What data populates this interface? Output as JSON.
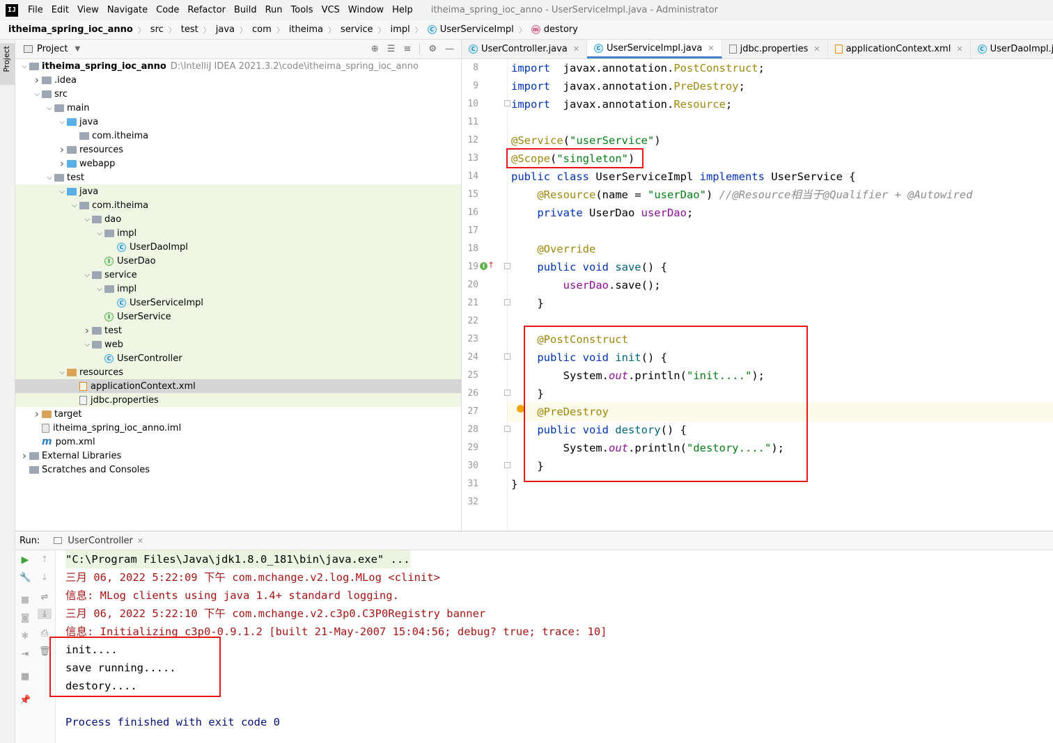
{
  "menubar": {
    "logo": "IJ",
    "items": [
      "File",
      "Edit",
      "View",
      "Navigate",
      "Code",
      "Refactor",
      "Build",
      "Run",
      "Tools",
      "VCS",
      "Window",
      "Help"
    ],
    "window_title": "itheima_spring_ioc_anno - UserServiceImpl.java - Administrator"
  },
  "breadcrumb": {
    "project": "itheima_spring_ioc_anno",
    "parts": [
      "src",
      "test",
      "java",
      "com",
      "itheima",
      "service",
      "impl"
    ],
    "class": "UserServiceImpl",
    "method": "destory"
  },
  "sidebar": {
    "tab": "Project"
  },
  "project_panel": {
    "title": "Project",
    "tree": [
      {
        "label": "itheima_spring_ioc_anno",
        "path": "D:\\IntelliJ IDEA 2021.3.2\\code\\itheima_spring_ioc_anno"
      },
      {
        "label": ".idea"
      },
      {
        "label": "src"
      },
      {
        "label": "main"
      },
      {
        "label": "java"
      },
      {
        "label": "com.itheima"
      },
      {
        "label": "resources"
      },
      {
        "label": "webapp"
      },
      {
        "label": "test"
      },
      {
        "label": "java"
      },
      {
        "label": "com.itheima"
      },
      {
        "label": "dao"
      },
      {
        "label": "impl"
      },
      {
        "label": "UserDaoImpl"
      },
      {
        "label": "UserDao"
      },
      {
        "label": "service"
      },
      {
        "label": "impl"
      },
      {
        "label": "UserServiceImpl"
      },
      {
        "label": "UserService"
      },
      {
        "label": "test"
      },
      {
        "label": "web"
      },
      {
        "label": "UserController"
      },
      {
        "label": "resources"
      },
      {
        "label": "applicationContext.xml"
      },
      {
        "label": "jdbc.properties"
      },
      {
        "label": "target"
      },
      {
        "label": "itheima_spring_ioc_anno.iml"
      },
      {
        "label": "pom.xml"
      },
      {
        "label": "External Libraries"
      },
      {
        "label": "Scratches and Consoles"
      }
    ]
  },
  "editor_tabs": [
    "UserController.java",
    "UserServiceImpl.java",
    "jdbc.properties",
    "applicationContext.xml",
    "UserDaoImpl.java"
  ],
  "editor": {
    "line_numbers": [
      "8",
      "9",
      "10",
      "11",
      "12",
      "13",
      "14",
      "15",
      "16",
      "17",
      "18",
      "19",
      "20",
      "21",
      "22",
      "23",
      "24",
      "25",
      "26",
      "27",
      "28",
      "29",
      "30",
      "31",
      "32"
    ],
    "lines": [
      [
        [
          "kw",
          "import"
        ],
        [
          "",
          "  javax.annotation."
        ],
        [
          "ann",
          "PostConstruct"
        ],
        [
          "",
          ";"
        ]
      ],
      [
        [
          "kw",
          "import"
        ],
        [
          "",
          "  javax.annotation."
        ],
        [
          "ann",
          "PreDestroy"
        ],
        [
          "",
          ";"
        ]
      ],
      [
        [
          "kw",
          "import"
        ],
        [
          "",
          "  javax.annotation."
        ],
        [
          "ann",
          "Resource"
        ],
        [
          "",
          ";"
        ]
      ],
      [],
      [
        [
          "ann",
          "@Service"
        ],
        [
          "",
          "("
        ],
        [
          "str",
          "\"userService\""
        ],
        [
          "",
          ")"
        ]
      ],
      [
        [
          "ann",
          "@Scope"
        ],
        [
          "",
          "("
        ],
        [
          "str",
          "\"singleton\""
        ],
        [
          "",
          ")"
        ]
      ],
      [
        [
          "kw",
          "public class "
        ],
        [
          "",
          "UserServiceImpl "
        ],
        [
          "kw",
          "implements "
        ],
        [
          "",
          "UserService {"
        ]
      ],
      [
        [
          "",
          "    "
        ],
        [
          "ann",
          "@Resource"
        ],
        [
          "",
          "(name = "
        ],
        [
          "str",
          "\"userDao\""
        ],
        [
          "",
          ") "
        ],
        [
          "cm",
          "//@Resource相当于@Qualifier + @Autowired"
        ]
      ],
      [
        [
          "",
          "    "
        ],
        [
          "kw",
          "private "
        ],
        [
          "",
          "UserDao "
        ],
        [
          "fld",
          "userDao"
        ],
        [
          "",
          ";"
        ]
      ],
      [],
      [
        [
          "",
          "    "
        ],
        [
          "ann",
          "@Override"
        ]
      ],
      [
        [
          "",
          "    "
        ],
        [
          "kw",
          "public void "
        ],
        [
          "meth",
          "save"
        ],
        [
          "",
          "() {"
        ]
      ],
      [
        [
          "",
          "        "
        ],
        [
          "fld",
          "userDao"
        ],
        [
          "",
          ".save();"
        ]
      ],
      [
        [
          "",
          "    }"
        ]
      ],
      [],
      [
        [
          "",
          "    "
        ],
        [
          "ann",
          "@PostConstruct"
        ]
      ],
      [
        [
          "",
          "    "
        ],
        [
          "kw",
          "public void "
        ],
        [
          "meth",
          "init"
        ],
        [
          "",
          "() {"
        ]
      ],
      [
        [
          "",
          "        System."
        ],
        [
          "stat",
          "out"
        ],
        [
          "",
          ".println("
        ],
        [
          "str",
          "\"init....\""
        ],
        [
          "",
          ");"
        ]
      ],
      [
        [
          "",
          "    }"
        ]
      ],
      [
        [
          "",
          "    "
        ],
        [
          "ann",
          "@PreDestroy"
        ]
      ],
      [
        [
          "",
          "    "
        ],
        [
          "kw",
          "public void "
        ],
        [
          "meth",
          "destory"
        ],
        [
          "",
          "() {"
        ]
      ],
      [
        [
          "",
          "        System."
        ],
        [
          "stat",
          "out"
        ],
        [
          "",
          ".println("
        ],
        [
          "str",
          "\"destory....\""
        ],
        [
          "",
          ");"
        ]
      ],
      [
        [
          "",
          "    }"
        ]
      ],
      [
        [
          "",
          "}"
        ]
      ],
      []
    ]
  },
  "run": {
    "label": "Run:",
    "tab": "UserController",
    "console": [
      {
        "cls": "blk",
        "text": "\"C:\\Program Files\\Java\\jdk1.8.0_181\\bin\\java.exe\" ..."
      },
      {
        "cls": "red",
        "text": "三月 06, 2022 5:22:09 下午 com.mchange.v2.log.MLog <clinit>"
      },
      {
        "cls": "red",
        "text": "信息: MLog clients using java 1.4+ standard logging."
      },
      {
        "cls": "red",
        "text": "三月 06, 2022 5:22:10 下午 com.mchange.v2.c3p0.C3P0Registry banner"
      },
      {
        "cls": "red",
        "text": "信息: Initializing c3p0-0.9.1.2 [built 21-May-2007 15:04:56; debug? true; trace: 10]"
      },
      {
        "cls": "blk",
        "text": "init...."
      },
      {
        "cls": "blk",
        "text": "save running....."
      },
      {
        "cls": "blk",
        "text": "destory...."
      },
      {
        "cls": "blk",
        "text": ""
      },
      {
        "cls": "navy",
        "text": "Process finished with exit code 0"
      }
    ]
  },
  "colors": {
    "highlight_box": "#e61717",
    "keyword": "#0033b3",
    "annotation": "#9e880d",
    "string": "#067d17"
  }
}
